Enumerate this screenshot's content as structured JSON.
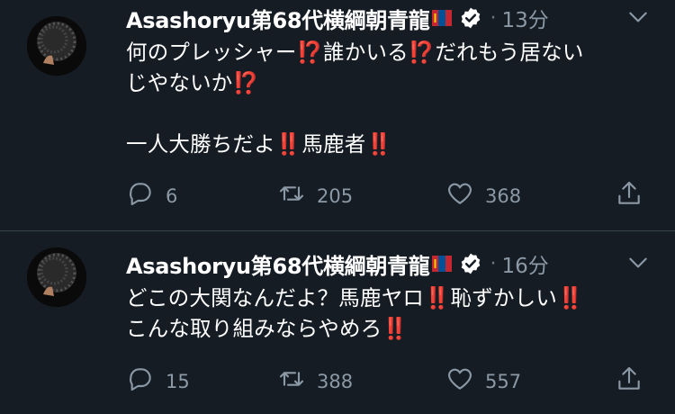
{
  "theme": {
    "background": "#151c24",
    "text": "#ffffff",
    "muted": "#8b98a5",
    "accent_red": "#e0245e"
  },
  "tweets": [
    {
      "author": "Asashoryu第68代横綱朝青龍",
      "time": "13分",
      "text": "何のプレッシャー⁉️誰かいる⁉️だれもう居ない\nじやないか⁉️\n\n一人大勝ちだよ‼️馬鹿者‼️",
      "replies": "6",
      "retweets": "205",
      "likes": "368"
    },
    {
      "author": "Asashoryu第68代横綱朝青龍",
      "time": "16分",
      "text": "どこの大関なんだよ？馬鹿ヤロ‼️恥ずかしい‼️\nこんな取り組みならやめろ‼️",
      "replies": "15",
      "retweets": "388",
      "likes": "557"
    }
  ],
  "icons": {
    "flag": "mongolia-flag-icon",
    "verified": "verified-badge-icon",
    "caret": "chevron-down-icon",
    "reply": "reply-icon",
    "retweet": "retweet-icon",
    "like": "heart-icon",
    "share": "share-icon"
  }
}
